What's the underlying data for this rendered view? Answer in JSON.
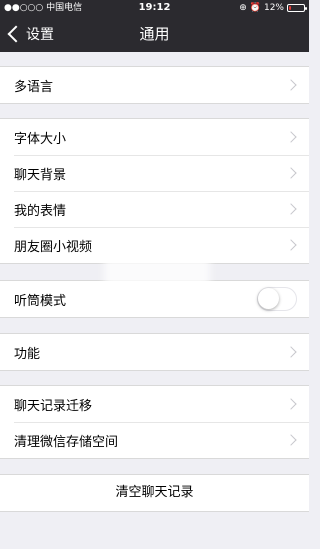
{
  "status_bar": {
    "carrier": "●●○○○ 中国电信",
    "time": "19:12",
    "battery": "12%"
  },
  "nav": {
    "back_label": "设置",
    "title": "通用"
  },
  "groups": [
    {
      "items": [
        {
          "label": "多语言"
        }
      ]
    },
    {
      "items": [
        {
          "label": "字体大小"
        },
        {
          "label": "聊天背景"
        },
        {
          "label": "我的表情"
        },
        {
          "label": "朋友圈小视频"
        }
      ]
    },
    {
      "items": [
        {
          "label": "听筒模式",
          "toggle": false
        }
      ]
    },
    {
      "items": [
        {
          "label": "功能"
        }
      ]
    },
    {
      "items": [
        {
          "label": "聊天记录迁移"
        },
        {
          "label": "清理微信存储空间"
        }
      ]
    }
  ],
  "clear_button": "清空聊天记录"
}
